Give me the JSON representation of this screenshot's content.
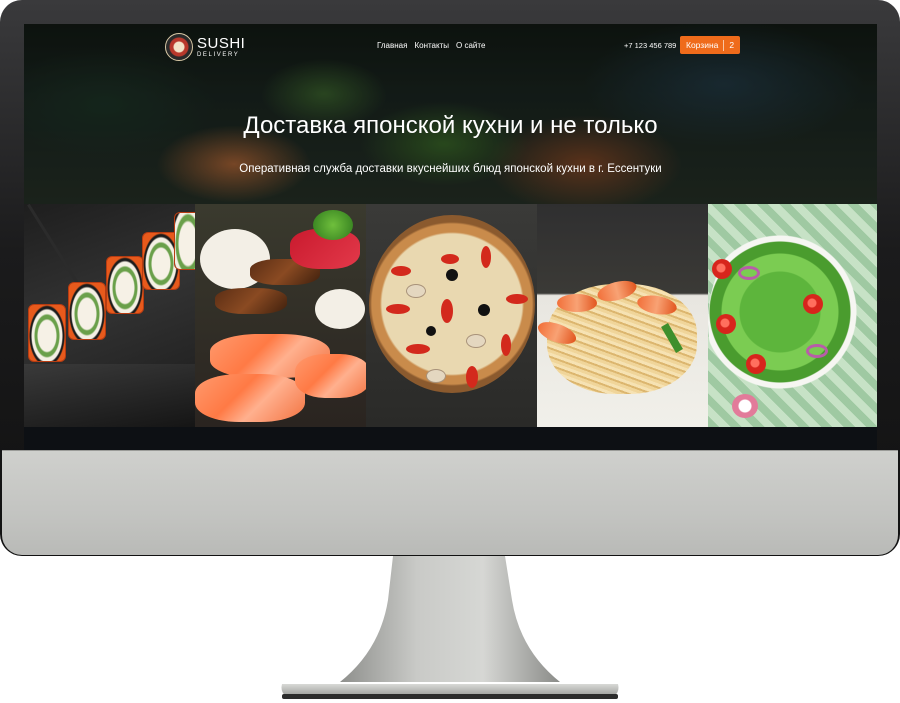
{
  "site": {
    "logo": {
      "title": "SUSHI",
      "subtitle": "DELIVERY"
    },
    "nav": {
      "items": [
        "Главная",
        "Контакты",
        "О сайте"
      ]
    },
    "phone": "+7 123 456 789",
    "cart": {
      "label": "Корзина",
      "count": "2"
    },
    "hero": {
      "title": "Доставка японской кухни и не только",
      "subtitle": "Оперативная служба доставки вкуснейших блюд японской кухни в г. Ессентуки"
    },
    "accent_color": "#ef6b1b",
    "tiles": [
      {
        "icon": "sushi-rolls-image"
      },
      {
        "icon": "nigiri-sushi-image"
      },
      {
        "icon": "pizza-image"
      },
      {
        "icon": "shrimp-noodles-image"
      },
      {
        "icon": "salad-image"
      }
    ]
  }
}
